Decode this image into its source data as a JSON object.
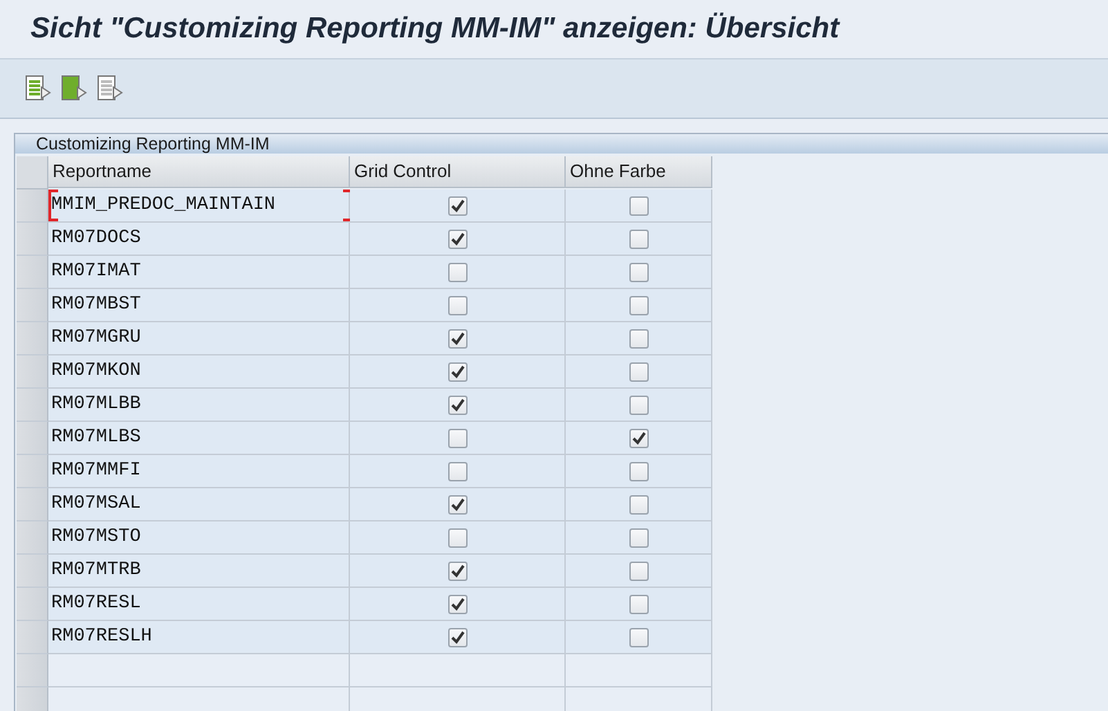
{
  "window": {
    "title": "Sicht \"Customizing Reporting MM-IM\" anzeigen: Übersicht"
  },
  "toolbar": {
    "buttons": [
      {
        "kind": "green"
      },
      {
        "kind": "greenfill"
      },
      {
        "kind": "grey"
      }
    ]
  },
  "table": {
    "title": "Customizing Reporting MM-IM",
    "columns": [
      "Reportname",
      "Grid Control",
      "Ohne Farbe"
    ],
    "rows": [
      {
        "reportname": "MMIM_PREDOC_MAINTAIN",
        "grid_control": true,
        "ohne_farbe": false,
        "focused": true
      },
      {
        "reportname": "RM07DOCS",
        "grid_control": true,
        "ohne_farbe": false,
        "focused": false
      },
      {
        "reportname": "RM07IMAT",
        "grid_control": false,
        "ohne_farbe": false,
        "focused": false
      },
      {
        "reportname": "RM07MBST",
        "grid_control": false,
        "ohne_farbe": false,
        "focused": false
      },
      {
        "reportname": "RM07MGRU",
        "grid_control": true,
        "ohne_farbe": false,
        "focused": false
      },
      {
        "reportname": "RM07MKON",
        "grid_control": true,
        "ohne_farbe": false,
        "focused": false
      },
      {
        "reportname": "RM07MLBB",
        "grid_control": true,
        "ohne_farbe": false,
        "focused": false
      },
      {
        "reportname": "RM07MLBS",
        "grid_control": false,
        "ohne_farbe": true,
        "focused": false
      },
      {
        "reportname": "RM07MMFI",
        "grid_control": false,
        "ohne_farbe": false,
        "focused": false
      },
      {
        "reportname": "RM07MSAL",
        "grid_control": true,
        "ohne_farbe": false,
        "focused": false
      },
      {
        "reportname": "RM07MSTO",
        "grid_control": false,
        "ohne_farbe": false,
        "focused": false
      },
      {
        "reportname": "RM07MTRB",
        "grid_control": true,
        "ohne_farbe": false,
        "focused": false
      },
      {
        "reportname": "RM07RESL",
        "grid_control": true,
        "ohne_farbe": false,
        "focused": false
      },
      {
        "reportname": "RM07RESLH",
        "grid_control": true,
        "ohne_farbe": false,
        "focused": false
      }
    ]
  }
}
